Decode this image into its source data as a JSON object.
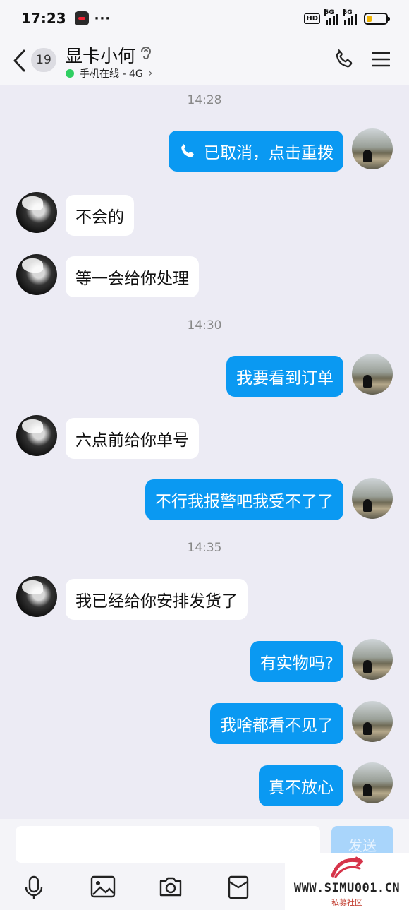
{
  "status_bar": {
    "time": "17:23",
    "more": "···",
    "hd": "HD",
    "net1": "5G",
    "net2": "5G",
    "battery_level": 0.25,
    "battery_color": "#f0b400"
  },
  "header": {
    "unread_count": "19",
    "contact_name": "显卡小何",
    "online_status": "手机在线 - 4G",
    "online_arrow": "›"
  },
  "messages": {
    "ts1": "14:28",
    "m1": "已取消，点击重拨",
    "m2": "不会的",
    "m3": "等一会给你处理",
    "ts2": "14:30",
    "m4": "我要看到订单",
    "m5": "六点前给你单号",
    "m6": "不行我报警吧我受不了了",
    "ts3": "14:35",
    "m7": "我已经给你安排发货了",
    "m8": "有实物吗?",
    "m9": "我啥都看不见了",
    "m10": "真不放心"
  },
  "input": {
    "value": "",
    "send_label": "发送"
  },
  "watermark": {
    "site": "WWW.SIMU001.CN",
    "name": "私募社区"
  },
  "colors": {
    "outgoing_bubble": "#0a99f2",
    "incoming_bubble": "#ffffff",
    "online": "#2fcf62"
  }
}
